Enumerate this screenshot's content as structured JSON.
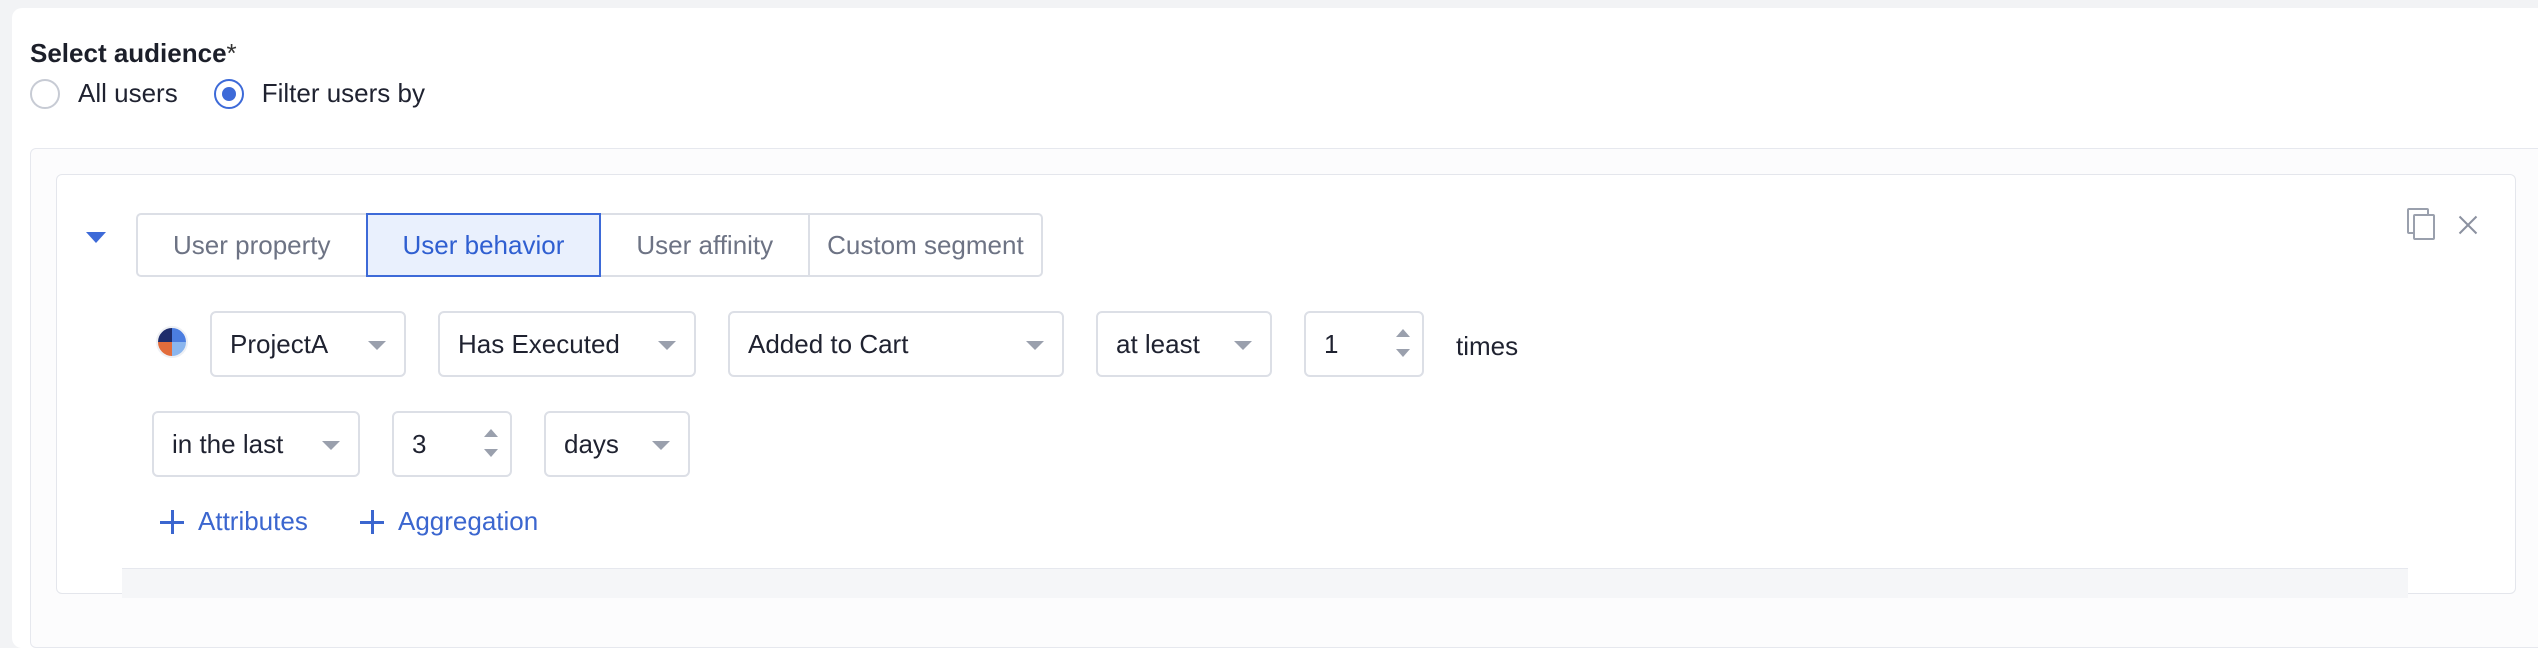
{
  "audience": {
    "title": "Select audience",
    "required_mark": "*",
    "options": [
      {
        "label": "All users",
        "checked": false
      },
      {
        "label": "Filter users by",
        "checked": true
      }
    ]
  },
  "filter": {
    "tabs": [
      {
        "label": "User property",
        "active": false
      },
      {
        "label": "User behavior",
        "active": true
      },
      {
        "label": "User affinity",
        "active": false
      },
      {
        "label": "Custom segment",
        "active": false
      }
    ],
    "row1": {
      "project": "ProjectA",
      "condition": "Has Executed",
      "event": "Added to Cart",
      "frequency": "at least",
      "count": "1",
      "count_unit": "times"
    },
    "row2": {
      "time_range": "in the last",
      "duration": "3",
      "duration_unit": "days"
    },
    "actions": {
      "attributes": "Attributes",
      "aggregation": "Aggregation"
    }
  },
  "colors": {
    "accent": "#3d6ad8",
    "link": "#3b66cf",
    "border": "#dcdfe6"
  },
  "icons": [
    "copy-icon",
    "close-icon",
    "collapse-caret-icon",
    "project-icon",
    "plus-icon"
  ]
}
